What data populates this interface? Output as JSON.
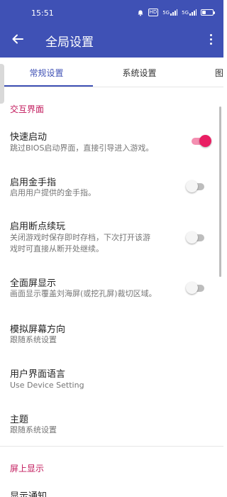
{
  "status_bar": {
    "time": "15:51",
    "hd_label": "HD",
    "signal_1": "5G",
    "signal_2": "5G",
    "battery_level": 0.35
  },
  "app_bar": {
    "back_icon": "arrow-left-icon",
    "title": "全局设置",
    "menu_icon": "more-vert-icon"
  },
  "tabs": [
    {
      "label": "常规设置",
      "active": true
    },
    {
      "label": "系统设置",
      "active": false
    },
    {
      "label": "图",
      "active": false
    }
  ],
  "sections": [
    {
      "header": "交互界面",
      "items": [
        {
          "title": "快速启动",
          "subtitle": "跳过BIOS启动界面，直接引导进入游戏。",
          "switch": true
        },
        {
          "title": "启用金手指",
          "subtitle": "启用用户提供的金手指。",
          "switch": false
        },
        {
          "title": "启用断点续玩",
          "subtitle_line1": "关闭游戏时保存即时存档，下次打开该游",
          "subtitle_line2": "戏时可直接从断开处继续。",
          "switch": false
        },
        {
          "title": "全面屏显示",
          "subtitle": "画面显示覆盖刘海屏(或挖孔屏)裁切区域。",
          "switch": false
        },
        {
          "title": "模拟屏幕方向",
          "subtitle": "跟随系统设置"
        },
        {
          "title": "用户界面语言",
          "subtitle": "Use Device Setting"
        },
        {
          "title": "主题",
          "subtitle": "跟随系统设置"
        }
      ]
    },
    {
      "header": "屏上显示",
      "items": [
        {
          "title": "显示通知"
        }
      ]
    }
  ],
  "colors": {
    "primary": "#3f51b5",
    "accent": "#e91e63",
    "section_header": "#c2185b"
  }
}
